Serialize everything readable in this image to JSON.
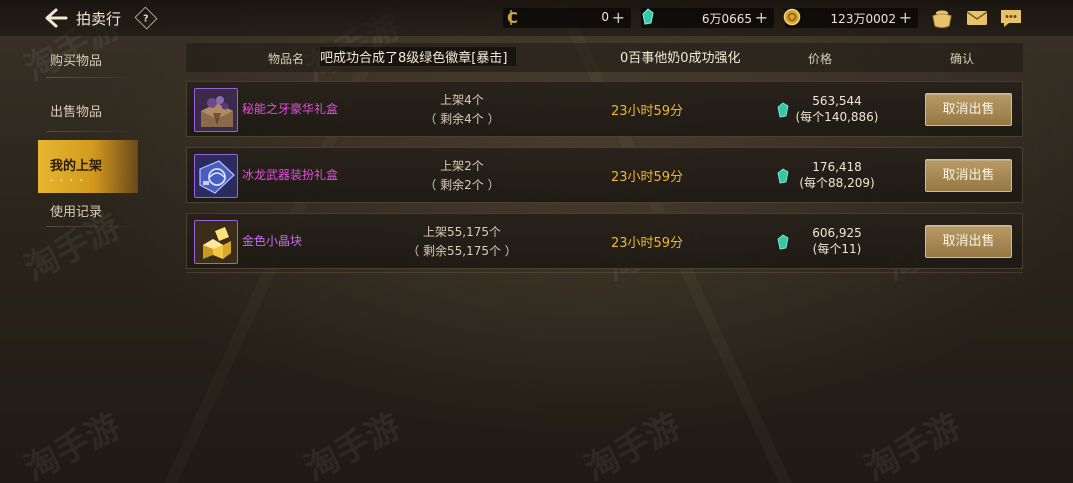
{
  "header": {
    "title": "拍卖行",
    "help_label": "?"
  },
  "currencies": [
    {
      "name": "c-coin",
      "value": "0",
      "color": "#c9a24a"
    },
    {
      "name": "gem",
      "value": "6万0665",
      "color": "#3fd0b0"
    },
    {
      "name": "gold",
      "value": "123万0002",
      "color": "#d6a12c"
    }
  ],
  "sidebar": {
    "items": [
      {
        "label": "购买物品",
        "active": false
      },
      {
        "label": "出售物品",
        "active": false
      },
      {
        "label": "我的上架",
        "active": true
      },
      {
        "label": "使用记录",
        "active": false
      }
    ],
    "active_dots": "· · · ·"
  },
  "table": {
    "columns": {
      "name": "物品名",
      "price": "价格",
      "confirm": "确认"
    },
    "marquee": {
      "part1": "吧成功合成了8级绿色徽章[暴击]",
      "part2": "0百事他奶0成功强化"
    },
    "rows": [
      {
        "name": "秘能之牙豪华礼盒",
        "name_color": "#e34fe0",
        "qty_line1": "上架4个",
        "qty_line2": "（ 剩余4个 ）",
        "time": "23小时59分",
        "price_total": "563,544",
        "price_each": "(每个140,886)",
        "button": "取消出售"
      },
      {
        "name": "冰龙武器装扮礼盒",
        "name_color": "#e34fe0",
        "qty_line1": "上架2个",
        "qty_line2": "（ 剩余2个 ）",
        "time": "23小时59分",
        "price_total": "176,418",
        "price_each": "(每个88,209)",
        "button": "取消出售"
      },
      {
        "name": "金色小晶块",
        "name_color": "#c86af0",
        "qty_line1": "上架55,175个",
        "qty_line2": "（ 剩余55,175个 ）",
        "time": "23小时59分",
        "price_total": "606,925",
        "price_each": "(每个11)",
        "button": "取消出售"
      }
    ]
  }
}
